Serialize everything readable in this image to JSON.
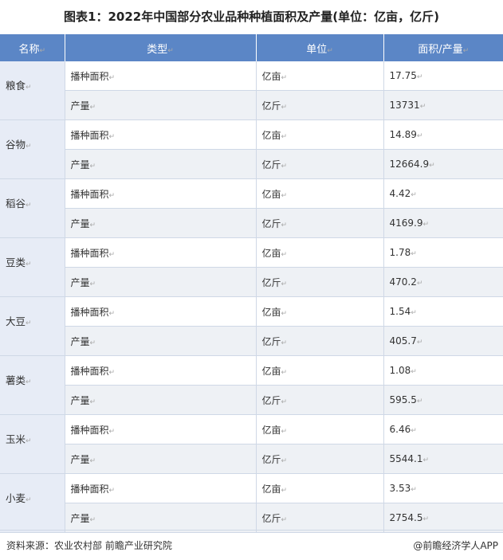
{
  "title": "图表1：2022年中国部分农业品种种植面积及产量(单位：亿亩，亿斤)",
  "headers": [
    "名称",
    "类型",
    "单位",
    "面积/产量"
  ],
  "rows": [
    {
      "group": "粮食",
      "items": [
        {
          "type": "播种面积",
          "unit": "亿亩",
          "value": "17.75"
        },
        {
          "type": "产量",
          "unit": "亿斤",
          "value": "13731"
        }
      ]
    },
    {
      "group": "谷物",
      "items": [
        {
          "type": "播种面积",
          "unit": "亿亩",
          "value": "14.89"
        },
        {
          "type": "产量",
          "unit": "亿斤",
          "value": "12664.9"
        }
      ]
    },
    {
      "group": "稻谷",
      "items": [
        {
          "type": "播种面积",
          "unit": "亿亩",
          "value": "4.42"
        },
        {
          "type": "产量",
          "unit": "亿斤",
          "value": "4169.9"
        }
      ]
    },
    {
      "group": "豆类",
      "items": [
        {
          "type": "播种面积",
          "unit": "亿亩",
          "value": "1.78"
        },
        {
          "type": "产量",
          "unit": "亿斤",
          "value": "470.2"
        }
      ]
    },
    {
      "group": "大豆",
      "items": [
        {
          "type": "播种面积",
          "unit": "亿亩",
          "value": "1.54"
        },
        {
          "type": "产量",
          "unit": "亿斤",
          "value": "405.7"
        }
      ]
    },
    {
      "group": "薯类",
      "items": [
        {
          "type": "播种面积",
          "unit": "亿亩",
          "value": "1.08"
        },
        {
          "type": "产量",
          "unit": "亿斤",
          "value": "595.5"
        }
      ]
    },
    {
      "group": "玉米",
      "items": [
        {
          "type": "播种面积",
          "unit": "亿亩",
          "value": "6.46"
        },
        {
          "type": "产量",
          "unit": "亿斤",
          "value": "5544.1"
        }
      ]
    },
    {
      "group": "小麦",
      "items": [
        {
          "type": "播种面积",
          "unit": "亿亩",
          "value": "3.53"
        },
        {
          "type": "产量",
          "unit": "亿斤",
          "value": "2754.5"
        }
      ]
    }
  ],
  "footer": {
    "source": "资料来源：农业农村部 前瞻产业研究院",
    "brand": "@前瞻经济学人APP"
  }
}
